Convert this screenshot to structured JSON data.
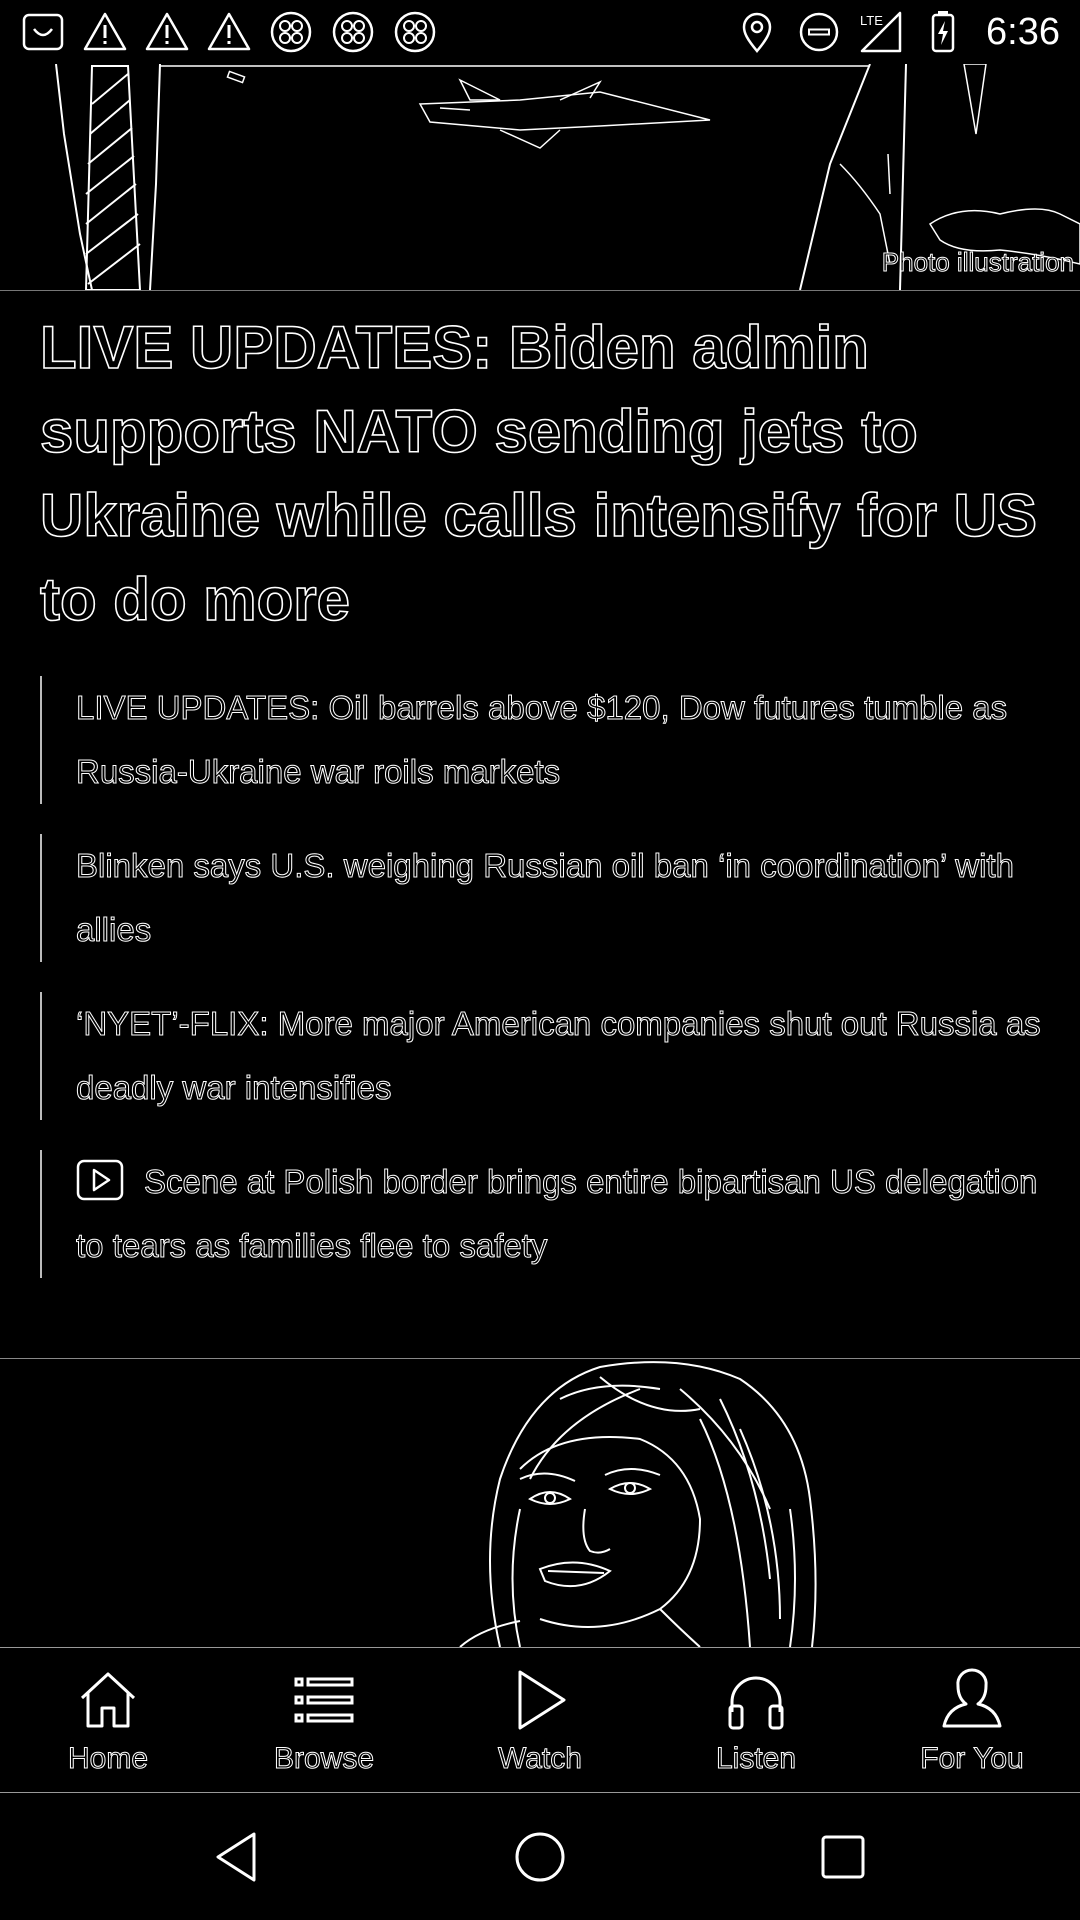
{
  "status_bar": {
    "time": "6:36",
    "left_icons": [
      "bag-notification-icon",
      "warning-icon",
      "warning-icon",
      "warning-icon",
      "app-notification-icon",
      "app-notification-icon",
      "app-notification-icon"
    ],
    "right_icons": [
      "location-icon",
      "do-not-disturb-icon",
      "lte-signal-icon",
      "battery-charging-icon"
    ],
    "network_label": "LTE"
  },
  "hero": {
    "photo_credit": "Photo illustration"
  },
  "article": {
    "headline": "LIVE UPDATES: Biden admin supports NATO sending jets to Ukraine while calls intensify for US to do more",
    "related": [
      {
        "text": "LIVE UPDATES: Oil barrels above $120, Dow futures tumble as Russia-Ukraine war roils markets",
        "video": false
      },
      {
        "text": "Blinken says U.S. weighing Russian oil ban ‘in coordination’ with allies",
        "video": false
      },
      {
        "text": "‘NYET’-FLIX: More major American companies shut out Russia as deadly war intensifies",
        "video": false
      },
      {
        "text": "Scene at Polish border brings entire bipartisan US delegation to tears as families flee to safety",
        "video": true
      }
    ]
  },
  "bottom_nav": {
    "items": [
      {
        "label": "Home",
        "icon": "home-icon"
      },
      {
        "label": "Browse",
        "icon": "list-icon"
      },
      {
        "label": "Watch",
        "icon": "play-icon"
      },
      {
        "label": "Listen",
        "icon": "headphones-icon"
      },
      {
        "label": "For You",
        "icon": "person-icon"
      }
    ]
  },
  "system_nav": {
    "buttons": [
      "back-icon",
      "home-circle-icon",
      "recents-icon"
    ]
  }
}
